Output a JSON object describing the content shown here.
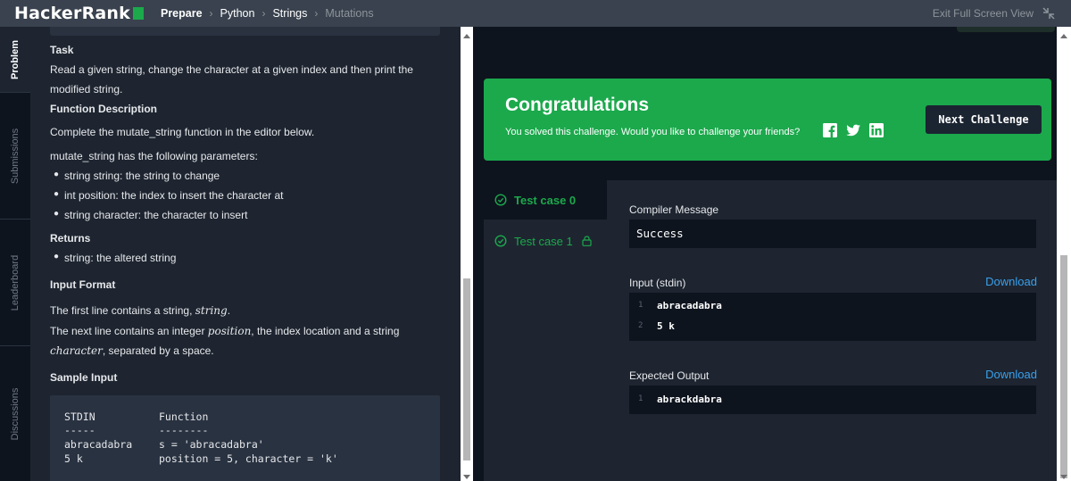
{
  "header": {
    "logo_text": "HackerRank",
    "breadcrumbs": [
      "Prepare",
      "Python",
      "Strings",
      "Mutations"
    ],
    "exit_label": "Exit Full Screen View"
  },
  "side_tabs": {
    "problem": "Problem",
    "submissions": "Submissions",
    "leaderboard": "Leaderboard",
    "discussions": "Discussions"
  },
  "problem": {
    "task_heading": "Task",
    "task_line1": "Read a given string, change the character at a given index and then print the",
    "task_line2": "modified string.",
    "func_desc_heading": "Function Description",
    "func_desc_text": "Complete the mutate_string function in the editor below.",
    "params_intro": "mutate_string has the following parameters:",
    "params": [
      "string string: the string to change",
      "int position: the index to insert the character at",
      "string character: the character to insert"
    ],
    "returns_heading": "Returns",
    "returns_items": [
      "string: the altered string"
    ],
    "input_format_heading": "Input Format",
    "input_line1_prefix": "The first line contains a string, ",
    "input_line1_math": "string",
    "input_line1_suffix": ".",
    "input_line2_prefix": "The next line contains an integer ",
    "input_line2_math": "position",
    "input_line2_suffix": ", the index location and a string",
    "input_line3_math": "character",
    "input_line3_suffix": ", separated by a space.",
    "sample_input_heading": "Sample Input",
    "sample": {
      "col1": [
        "STDIN",
        "-----",
        "abracadabra",
        "5 k"
      ],
      "col2": [
        "Function",
        "--------",
        "s = 'abracadabra'",
        "position = 5, character = 'k'"
      ]
    }
  },
  "result": {
    "title": "Congratulations",
    "message": "You solved this challenge. Would you like to challenge your friends?",
    "next_button": "Next Challenge",
    "test_cases": [
      "Test case 0",
      "Test case 1"
    ],
    "compiler_label": "Compiler Message",
    "compiler_value": "Success",
    "input_label": "Input (stdin)",
    "download_label": "Download",
    "input_lines": [
      {
        "n": "1",
        "v": "abracadabra"
      },
      {
        "n": "2",
        "v": "5 k"
      }
    ],
    "expected_label": "Expected Output",
    "expected_lines": [
      {
        "n": "1",
        "v": "abrackdabra"
      }
    ]
  },
  "colors": {
    "header_bg": "#39424e",
    "success_green": "#1ba94c",
    "link_blue": "#39a0ed",
    "panel_bg": "#1e2530",
    "page_bg": "#0e141e"
  },
  "icons": [
    "check-circle-icon",
    "lock-icon",
    "facebook-icon",
    "twitter-icon",
    "linkedin-icon",
    "exit-fullscreen-icon"
  ]
}
